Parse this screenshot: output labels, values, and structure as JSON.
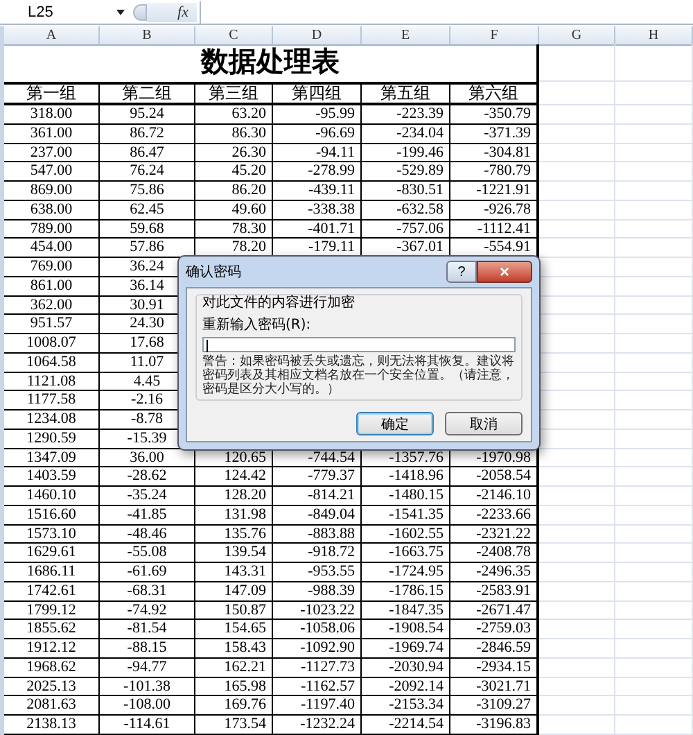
{
  "name_box": "L25",
  "function_label": "fx",
  "column_headers": [
    "A",
    "B",
    "C",
    "D",
    "E",
    "F",
    "G",
    "H"
  ],
  "sheet_title": "数据处理表",
  "group_headers": [
    "第一组",
    "第二组",
    "第三组",
    "第四组",
    "第五组",
    "第六组"
  ],
  "rows": [
    [
      "318.00",
      "95.24",
      "63.20",
      "-95.99",
      "-223.39",
      "-350.79"
    ],
    [
      "361.00",
      "86.72",
      "86.30",
      "-96.69",
      "-234.04",
      "-371.39"
    ],
    [
      "237.00",
      "86.47",
      "26.30",
      "-94.11",
      "-199.46",
      "-304.81"
    ],
    [
      "547.00",
      "76.24",
      "45.20",
      "-278.99",
      "-529.89",
      "-780.79"
    ],
    [
      "869.00",
      "75.86",
      "86.20",
      "-439.11",
      "-830.51",
      "-1221.91"
    ],
    [
      "638.00",
      "62.45",
      "49.60",
      "-338.38",
      "-632.58",
      "-926.78"
    ],
    [
      "789.00",
      "59.68",
      "78.30",
      "-401.71",
      "-757.06",
      "-1112.41"
    ],
    [
      "454.00",
      "57.86",
      "78.20",
      "-179.11",
      "-367.01",
      "-554.91"
    ],
    [
      "769.00",
      "36.24",
      null,
      null,
      null,
      null
    ],
    [
      "861.00",
      "36.14",
      null,
      null,
      null,
      null
    ],
    [
      "362.00",
      "30.91",
      null,
      null,
      null,
      null
    ],
    [
      "951.57",
      "24.30",
      null,
      null,
      null,
      null
    ],
    [
      "1008.07",
      "17.68",
      null,
      null,
      null,
      null
    ],
    [
      "1064.58",
      "11.07",
      null,
      null,
      null,
      null
    ],
    [
      "1121.08",
      "4.45",
      null,
      null,
      null,
      null
    ],
    [
      "1177.58",
      "-2.16",
      null,
      null,
      null,
      null
    ],
    [
      "1234.08",
      "-8.78",
      null,
      null,
      null,
      null
    ],
    [
      "1290.59",
      "-15.39",
      null,
      null,
      null,
      null
    ],
    [
      "1347.09",
      "36.00",
      "120.65",
      "-744.54",
      "-1357.76",
      "-1970.98"
    ],
    [
      "1403.59",
      "-28.62",
      "124.42",
      "-779.37",
      "-1418.96",
      "-2058.54"
    ],
    [
      "1460.10",
      "-35.24",
      "128.20",
      "-814.21",
      "-1480.15",
      "-2146.10"
    ],
    [
      "1516.60",
      "-41.85",
      "131.98",
      "-849.04",
      "-1541.35",
      "-2233.66"
    ],
    [
      "1573.10",
      "-48.46",
      "135.76",
      "-883.88",
      "-1602.55",
      "-2321.22"
    ],
    [
      "1629.61",
      "-55.08",
      "139.54",
      "-918.72",
      "-1663.75",
      "-2408.78"
    ],
    [
      "1686.11",
      "-61.69",
      "143.31",
      "-953.55",
      "-1724.95",
      "-2496.35"
    ],
    [
      "1742.61",
      "-68.31",
      "147.09",
      "-988.39",
      "-1786.15",
      "-2583.91"
    ],
    [
      "1799.12",
      "-74.92",
      "150.87",
      "-1023.22",
      "-1847.35",
      "-2671.47"
    ],
    [
      "1855.62",
      "-81.54",
      "154.65",
      "-1058.06",
      "-1908.54",
      "-2759.03"
    ],
    [
      "1912.12",
      "-88.15",
      "158.43",
      "-1092.90",
      "-1969.74",
      "-2846.59"
    ],
    [
      "1968.62",
      "-94.77",
      "162.21",
      "-1127.73",
      "-2030.94",
      "-2934.15"
    ],
    [
      "2025.13",
      "-101.38",
      "165.98",
      "-1162.57",
      "-2092.14",
      "-3021.71"
    ],
    [
      "2081.63",
      "-108.00",
      "169.76",
      "-1197.40",
      "-2153.34",
      "-3109.27"
    ],
    [
      "2138.13",
      "-114.61",
      "173.54",
      "-1232.24",
      "-2214.54",
      "-3196.83"
    ]
  ],
  "dialog": {
    "title": "确认密码",
    "help": "?",
    "close": "×",
    "group_title": "对此文件的内容进行加密",
    "field_label": "重新输入密码(R):",
    "warning": "警告：如果密码被丢失或遗忘，则无法将其恢复。建议将密码列表及其相应文档名放在一个安全位置。（请注意，密码是区分大小写的。）",
    "buttons": [
      "确定",
      "取消"
    ]
  }
}
